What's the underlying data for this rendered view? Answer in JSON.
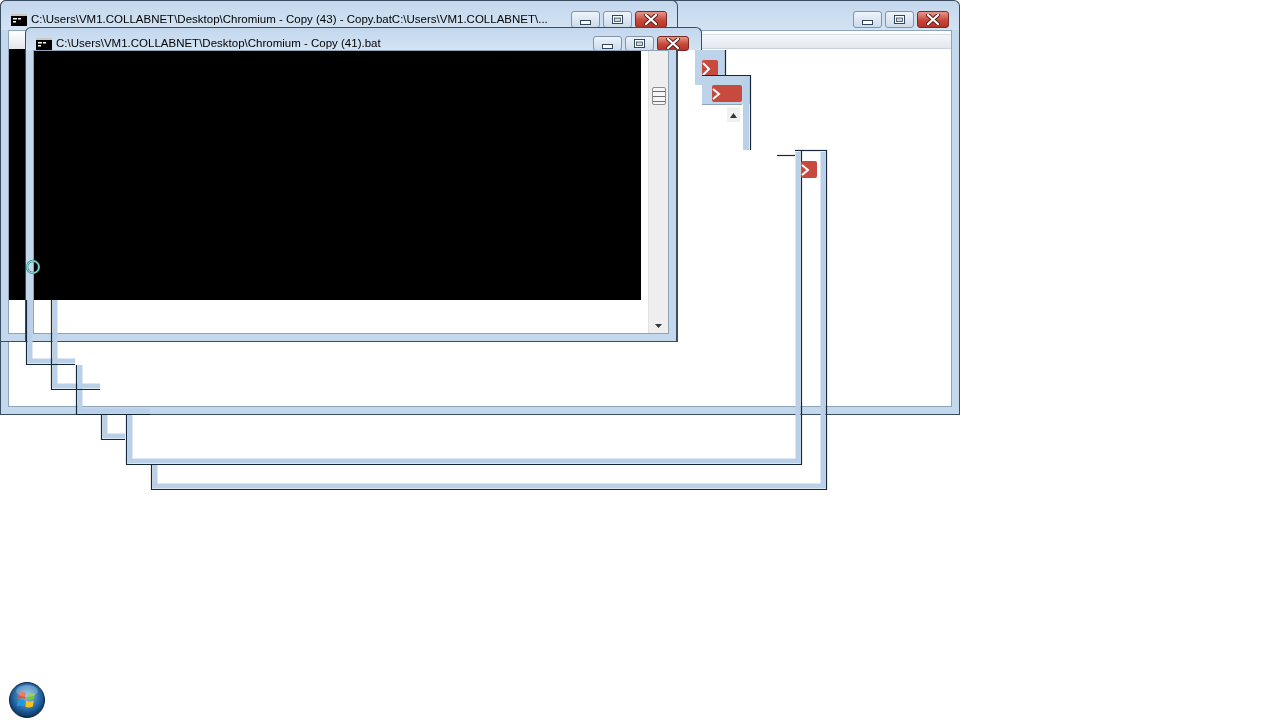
{
  "windows": [
    {
      "kind": "plain"
    },
    {
      "kind": "console",
      "title": "C:\\Users\\VM1.COLLABNET\\Desktop\\Chromium - Copy (43) - Copy.batC:\\Users\\VM1.COLLABNET\\..."
    },
    {
      "kind": "console",
      "title": "C:\\Users\\VM1.COLLABNET\\Desktop\\Chromium - Copy (41).bat"
    }
  ]
}
